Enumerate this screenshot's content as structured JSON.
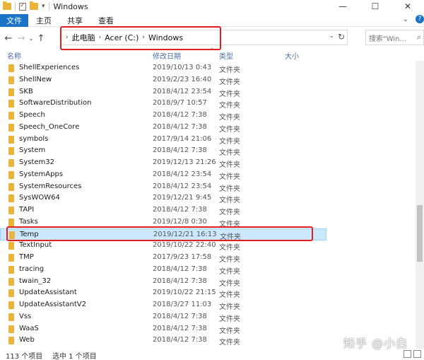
{
  "window": {
    "title": "Windows",
    "minimize": "—",
    "maximize": "☐",
    "close": "✕"
  },
  "ribbon": {
    "tabs": [
      "文件",
      "主页",
      "共享",
      "查看"
    ],
    "expand": "⌄",
    "help": "?"
  },
  "nav": {
    "back": "←",
    "forward": "→",
    "recent": "⌄",
    "up": "↑",
    "breadcrumb": [
      "此电脑",
      "Acer (C:)",
      "Windows"
    ],
    "arrow": "›",
    "refresh": "↻",
    "search_placeholder": "搜索\"Win...",
    "search_icon": "⌕"
  },
  "columns": {
    "name": "名称",
    "modified": "修改日期",
    "type": "类型",
    "size": "大小",
    "sort_arrow": "^"
  },
  "files": [
    {
      "name": "ShellExperiences",
      "date": "2019/10/13 0:43",
      "type": "文件夹"
    },
    {
      "name": "ShellNew",
      "date": "2019/2/23 16:40",
      "type": "文件夹"
    },
    {
      "name": "SKB",
      "date": "2018/4/12 23:54",
      "type": "文件夹"
    },
    {
      "name": "SoftwareDistribution",
      "date": "2018/9/7 10:57",
      "type": "文件夹"
    },
    {
      "name": "Speech",
      "date": "2018/4/12 7:38",
      "type": "文件夹"
    },
    {
      "name": "Speech_OneCore",
      "date": "2018/4/12 7:38",
      "type": "文件夹"
    },
    {
      "name": "symbols",
      "date": "2017/9/14 21:06",
      "type": "文件夹"
    },
    {
      "name": "System",
      "date": "2018/4/12 7:38",
      "type": "文件夹"
    },
    {
      "name": "System32",
      "date": "2019/12/13 21:26",
      "type": "文件夹"
    },
    {
      "name": "SystemApps",
      "date": "2018/4/12 23:54",
      "type": "文件夹"
    },
    {
      "name": "SystemResources",
      "date": "2018/4/12 23:54",
      "type": "文件夹"
    },
    {
      "name": "SysWOW64",
      "date": "2019/12/21 9:45",
      "type": "文件夹"
    },
    {
      "name": "TAPI",
      "date": "2018/4/12 7:38",
      "type": "文件夹"
    },
    {
      "name": "Tasks",
      "date": "2019/12/8 0:30",
      "type": "文件夹"
    },
    {
      "name": "Temp",
      "date": "2019/12/21 16:13",
      "type": "文件夹",
      "selected": true
    },
    {
      "name": "TextInput",
      "date": "2019/10/22 22:40",
      "type": "文件夹"
    },
    {
      "name": "TMP",
      "date": "2017/9/23 17:58",
      "type": "文件夹"
    },
    {
      "name": "tracing",
      "date": "2018/4/12 7:38",
      "type": "文件夹"
    },
    {
      "name": "twain_32",
      "date": "2018/4/12 7:38",
      "type": "文件夹"
    },
    {
      "name": "UpdateAssistant",
      "date": "2019/10/22 21:15",
      "type": "文件夹"
    },
    {
      "name": "UpdateAssistantV2",
      "date": "2018/3/27 11:03",
      "type": "文件夹"
    },
    {
      "name": "Vss",
      "date": "2018/4/12 7:38",
      "type": "文件夹"
    },
    {
      "name": "WaaS",
      "date": "2018/4/12 7:38",
      "type": "文件夹"
    },
    {
      "name": "Web",
      "date": "2018/4/12 7:38",
      "type": "文件夹"
    }
  ],
  "status": {
    "count": "113 个项目",
    "selected": "选中 1 个项目"
  },
  "watermark": "知乎 @小白",
  "colors": {
    "accent": "#1a73c8",
    "selection": "#cce8ff",
    "annotation": "#e02020",
    "folder": "#e8b43a"
  }
}
